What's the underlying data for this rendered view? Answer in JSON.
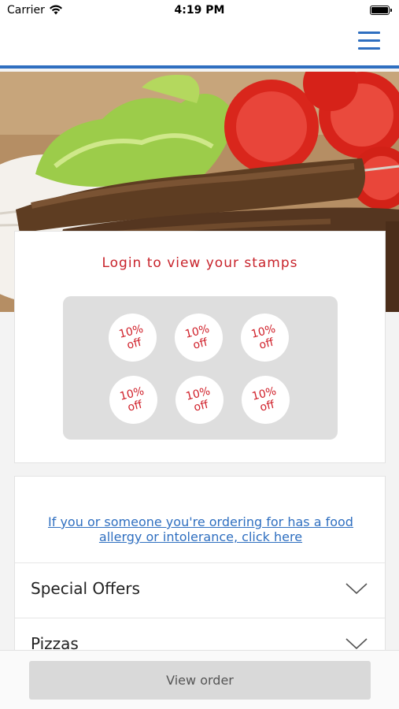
{
  "status_bar": {
    "carrier": "Carrier",
    "time": "4:19 PM"
  },
  "nav": {
    "menu_icon": "hamburger-menu-icon",
    "accent": "#2f6fc0"
  },
  "hero": {
    "image": "grilled kebab skewers with lettuce and tomato"
  },
  "stamps": {
    "title": "Login to view your stamps",
    "items": [
      {
        "line1": "10%",
        "line2": "off"
      },
      {
        "line1": "10%",
        "line2": "off"
      },
      {
        "line1": "10%",
        "line2": "off"
      },
      {
        "line1": "10%",
        "line2": "off"
      },
      {
        "line1": "10%",
        "line2": "off"
      },
      {
        "line1": "10%",
        "line2": "off"
      }
    ]
  },
  "allergy": {
    "link_text": "If you or someone you're ordering for has a food allergy or intolerance, click here"
  },
  "menu": {
    "sections": [
      {
        "label": "Special Offers"
      },
      {
        "label": "Pizzas"
      }
    ]
  },
  "footer": {
    "view_order_label": "View order"
  }
}
